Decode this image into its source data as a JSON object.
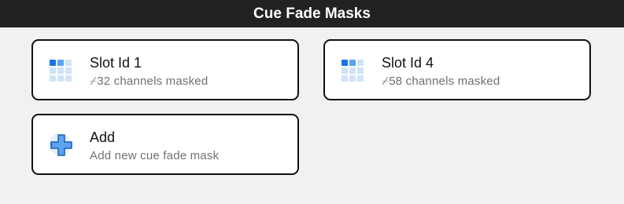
{
  "window": {
    "title": "Cue Fade Masks"
  },
  "colors": {
    "titlebar_bg": "#222222",
    "page_bg": "#f1f1f1",
    "accent_blue": "#1a73e8",
    "grid_light": "#cfe3f9"
  },
  "cards": [
    {
      "title": "Slot Id 1",
      "subtitle": "⌿32 channels masked",
      "icon": "grid-icon"
    },
    {
      "title": "Slot Id 4",
      "subtitle": "⌿58 channels masked",
      "icon": "grid-icon"
    },
    {
      "title": "Add",
      "subtitle": "Add new cue fade mask",
      "icon": "plus-icon"
    }
  ]
}
